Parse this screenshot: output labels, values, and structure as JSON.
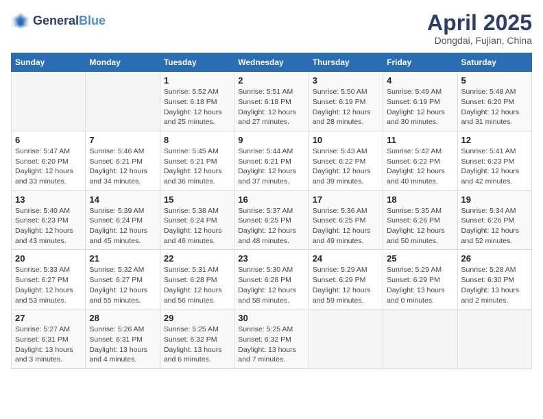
{
  "header": {
    "logo_general": "General",
    "logo_blue": "Blue",
    "month_year": "April 2025",
    "location": "Dongdai, Fujian, China"
  },
  "weekdays": [
    "Sunday",
    "Monday",
    "Tuesday",
    "Wednesday",
    "Thursday",
    "Friday",
    "Saturday"
  ],
  "weeks": [
    [
      {
        "day": "",
        "sunrise": "",
        "sunset": "",
        "daylight": ""
      },
      {
        "day": "",
        "sunrise": "",
        "sunset": "",
        "daylight": ""
      },
      {
        "day": "1",
        "sunrise": "Sunrise: 5:52 AM",
        "sunset": "Sunset: 6:18 PM",
        "daylight": "Daylight: 12 hours and 25 minutes."
      },
      {
        "day": "2",
        "sunrise": "Sunrise: 5:51 AM",
        "sunset": "Sunset: 6:18 PM",
        "daylight": "Daylight: 12 hours and 27 minutes."
      },
      {
        "day": "3",
        "sunrise": "Sunrise: 5:50 AM",
        "sunset": "Sunset: 6:19 PM",
        "daylight": "Daylight: 12 hours and 28 minutes."
      },
      {
        "day": "4",
        "sunrise": "Sunrise: 5:49 AM",
        "sunset": "Sunset: 6:19 PM",
        "daylight": "Daylight: 12 hours and 30 minutes."
      },
      {
        "day": "5",
        "sunrise": "Sunrise: 5:48 AM",
        "sunset": "Sunset: 6:20 PM",
        "daylight": "Daylight: 12 hours and 31 minutes."
      }
    ],
    [
      {
        "day": "6",
        "sunrise": "Sunrise: 5:47 AM",
        "sunset": "Sunset: 6:20 PM",
        "daylight": "Daylight: 12 hours and 33 minutes."
      },
      {
        "day": "7",
        "sunrise": "Sunrise: 5:46 AM",
        "sunset": "Sunset: 6:21 PM",
        "daylight": "Daylight: 12 hours and 34 minutes."
      },
      {
        "day": "8",
        "sunrise": "Sunrise: 5:45 AM",
        "sunset": "Sunset: 6:21 PM",
        "daylight": "Daylight: 12 hours and 36 minutes."
      },
      {
        "day": "9",
        "sunrise": "Sunrise: 5:44 AM",
        "sunset": "Sunset: 6:21 PM",
        "daylight": "Daylight: 12 hours and 37 minutes."
      },
      {
        "day": "10",
        "sunrise": "Sunrise: 5:43 AM",
        "sunset": "Sunset: 6:22 PM",
        "daylight": "Daylight: 12 hours and 39 minutes."
      },
      {
        "day": "11",
        "sunrise": "Sunrise: 5:42 AM",
        "sunset": "Sunset: 6:22 PM",
        "daylight": "Daylight: 12 hours and 40 minutes."
      },
      {
        "day": "12",
        "sunrise": "Sunrise: 5:41 AM",
        "sunset": "Sunset: 6:23 PM",
        "daylight": "Daylight: 12 hours and 42 minutes."
      }
    ],
    [
      {
        "day": "13",
        "sunrise": "Sunrise: 5:40 AM",
        "sunset": "Sunset: 6:23 PM",
        "daylight": "Daylight: 12 hours and 43 minutes."
      },
      {
        "day": "14",
        "sunrise": "Sunrise: 5:39 AM",
        "sunset": "Sunset: 6:24 PM",
        "daylight": "Daylight: 12 hours and 45 minutes."
      },
      {
        "day": "15",
        "sunrise": "Sunrise: 5:38 AM",
        "sunset": "Sunset: 6:24 PM",
        "daylight": "Daylight: 12 hours and 46 minutes."
      },
      {
        "day": "16",
        "sunrise": "Sunrise: 5:37 AM",
        "sunset": "Sunset: 6:25 PM",
        "daylight": "Daylight: 12 hours and 48 minutes."
      },
      {
        "day": "17",
        "sunrise": "Sunrise: 5:36 AM",
        "sunset": "Sunset: 6:25 PM",
        "daylight": "Daylight: 12 hours and 49 minutes."
      },
      {
        "day": "18",
        "sunrise": "Sunrise: 5:35 AM",
        "sunset": "Sunset: 6:26 PM",
        "daylight": "Daylight: 12 hours and 50 minutes."
      },
      {
        "day": "19",
        "sunrise": "Sunrise: 5:34 AM",
        "sunset": "Sunset: 6:26 PM",
        "daylight": "Daylight: 12 hours and 52 minutes."
      }
    ],
    [
      {
        "day": "20",
        "sunrise": "Sunrise: 5:33 AM",
        "sunset": "Sunset: 6:27 PM",
        "daylight": "Daylight: 12 hours and 53 minutes."
      },
      {
        "day": "21",
        "sunrise": "Sunrise: 5:32 AM",
        "sunset": "Sunset: 6:27 PM",
        "daylight": "Daylight: 12 hours and 55 minutes."
      },
      {
        "day": "22",
        "sunrise": "Sunrise: 5:31 AM",
        "sunset": "Sunset: 6:28 PM",
        "daylight": "Daylight: 12 hours and 56 minutes."
      },
      {
        "day": "23",
        "sunrise": "Sunrise: 5:30 AM",
        "sunset": "Sunset: 6:28 PM",
        "daylight": "Daylight: 12 hours and 58 minutes."
      },
      {
        "day": "24",
        "sunrise": "Sunrise: 5:29 AM",
        "sunset": "Sunset: 6:29 PM",
        "daylight": "Daylight: 12 hours and 59 minutes."
      },
      {
        "day": "25",
        "sunrise": "Sunrise: 5:29 AM",
        "sunset": "Sunset: 6:29 PM",
        "daylight": "Daylight: 13 hours and 0 minutes."
      },
      {
        "day": "26",
        "sunrise": "Sunrise: 5:28 AM",
        "sunset": "Sunset: 6:30 PM",
        "daylight": "Daylight: 13 hours and 2 minutes."
      }
    ],
    [
      {
        "day": "27",
        "sunrise": "Sunrise: 5:27 AM",
        "sunset": "Sunset: 6:31 PM",
        "daylight": "Daylight: 13 hours and 3 minutes."
      },
      {
        "day": "28",
        "sunrise": "Sunrise: 5:26 AM",
        "sunset": "Sunset: 6:31 PM",
        "daylight": "Daylight: 13 hours and 4 minutes."
      },
      {
        "day": "29",
        "sunrise": "Sunrise: 5:25 AM",
        "sunset": "Sunset: 6:32 PM",
        "daylight": "Daylight: 13 hours and 6 minutes."
      },
      {
        "day": "30",
        "sunrise": "Sunrise: 5:25 AM",
        "sunset": "Sunset: 6:32 PM",
        "daylight": "Daylight: 13 hours and 7 minutes."
      },
      {
        "day": "",
        "sunrise": "",
        "sunset": "",
        "daylight": ""
      },
      {
        "day": "",
        "sunrise": "",
        "sunset": "",
        "daylight": ""
      },
      {
        "day": "",
        "sunrise": "",
        "sunset": "",
        "daylight": ""
      }
    ]
  ]
}
